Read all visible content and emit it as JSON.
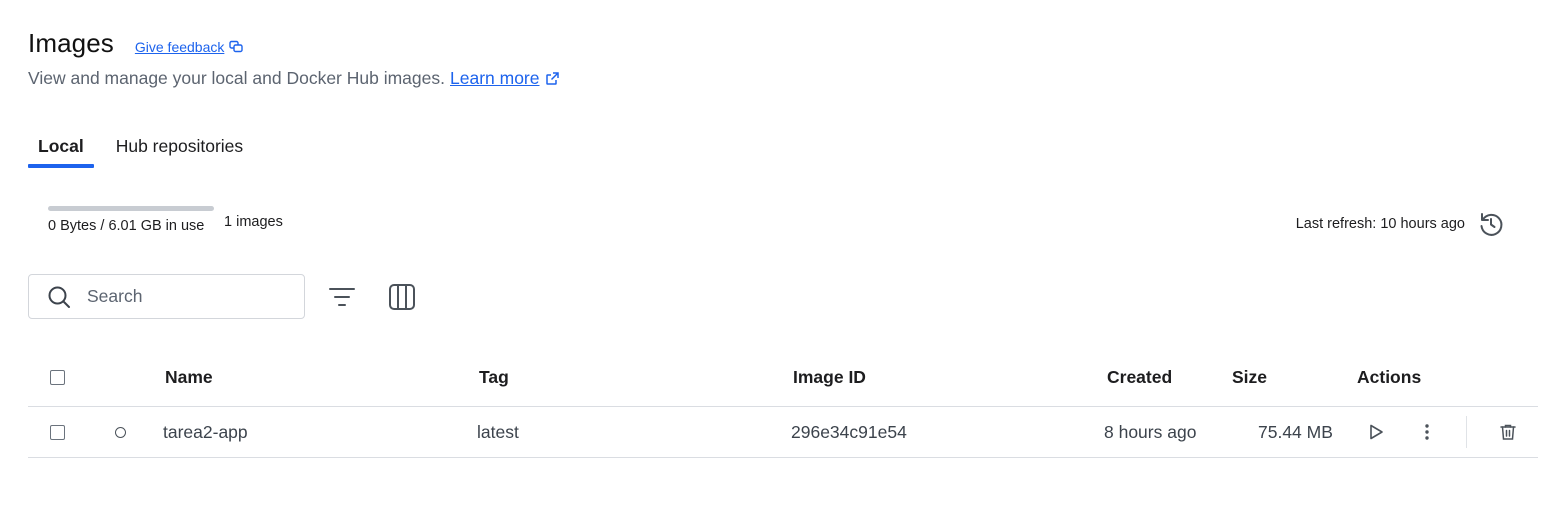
{
  "header": {
    "title": "Images",
    "feedback_label": "Give feedback",
    "subtitle": "View and manage your local and Docker Hub images.",
    "learn_more_label": "Learn more"
  },
  "tabs": [
    {
      "label": "Local",
      "active": true
    },
    {
      "label": "Hub repositories",
      "active": false
    }
  ],
  "usage": {
    "text": "0 Bytes / 6.01 GB in use",
    "fill_fraction": 0,
    "images_count": "1 images",
    "last_refresh": "Last refresh: 10 hours ago"
  },
  "search": {
    "placeholder": "Search",
    "value": ""
  },
  "table": {
    "columns": {
      "name": "Name",
      "tag": "Tag",
      "image_id": "Image ID",
      "created": "Created",
      "size": "Size",
      "actions": "Actions"
    },
    "rows": [
      {
        "name": "tarea2-app",
        "tag": "latest",
        "image_id": "296e34c91e54",
        "created": "8 hours ago",
        "size": "75.44 MB",
        "in_use": false
      }
    ]
  },
  "icons": {
    "feedback": "chat-bubbles-icon",
    "external_link": "external-link-icon",
    "refresh": "refresh-icon",
    "search": "search-icon",
    "filter": "filter-icon",
    "columns": "columns-icon",
    "run": "play-icon",
    "more": "more-vertical-icon",
    "delete": "trash-icon"
  },
  "colors": {
    "accent": "#1d63ed",
    "muted_text": "#5c6470",
    "border": "#dadde2"
  }
}
